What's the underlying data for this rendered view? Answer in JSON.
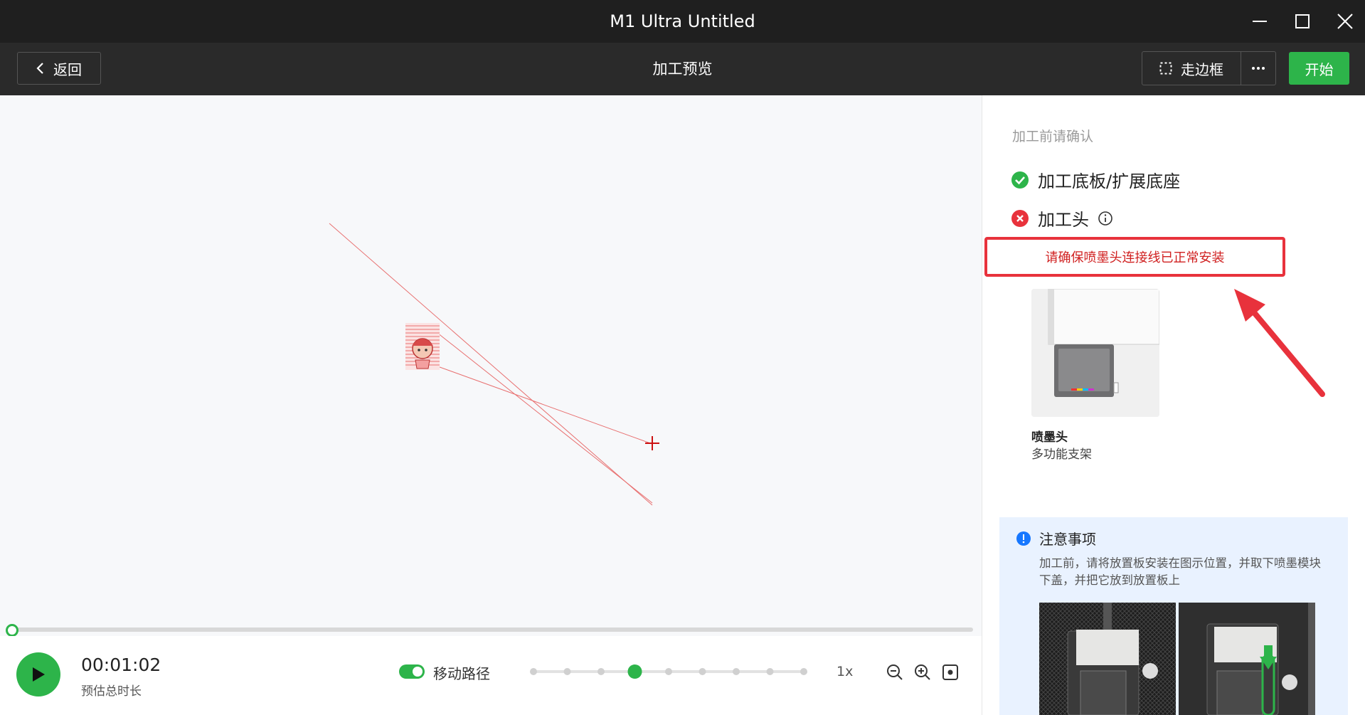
{
  "window": {
    "title": "M1 Ultra Untitled"
  },
  "toolbar": {
    "back_label": "返回",
    "page_title": "加工预览",
    "frame_label": "走边框",
    "more_label": "···",
    "start_label": "开始"
  },
  "player": {
    "progress": 0.0,
    "time_value": "00:01:02",
    "time_label": "预估总时长",
    "path_label": "移动路径",
    "path_enabled": true,
    "speed_steps": 9,
    "speed_selected_index": 3,
    "speed_label": "1x"
  },
  "checklist": {
    "heading": "加工前请确认",
    "items": [
      {
        "label": "加工底板/扩展底座",
        "status": "ok"
      },
      {
        "label": "加工头",
        "status": "error"
      }
    ],
    "warning": "请确保喷墨头连接线已正常安装",
    "module_title": "喷墨头",
    "module_subtitle": "多功能支架"
  },
  "notice": {
    "title": "注意事项",
    "text": "加工前，请将放置板安装在图示位置，并取下喷墨模块下盖，并把它放到放置板上"
  },
  "colors": {
    "accent": "#2db44a",
    "error": "#e8323c",
    "info": "#1677ff",
    "path": "#e87070"
  },
  "icons": {
    "back": "chevron-left-icon",
    "frame": "dashed-square-icon",
    "more": "more-dots-icon",
    "ok": "check-circle-icon",
    "error": "close-circle-icon",
    "info": "info-circle-icon",
    "play": "play-icon",
    "zoom_out": "zoom-out-icon",
    "zoom_in": "zoom-in-icon",
    "fit": "fit-view-icon"
  }
}
